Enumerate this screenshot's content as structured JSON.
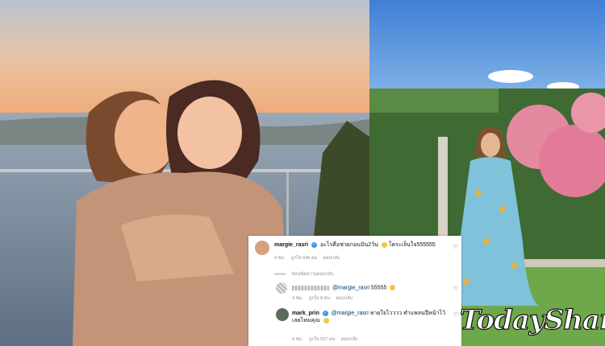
{
  "comments": [
    {
      "username": "margie_rasri",
      "text": "อะไรคือช่วยกอนปัน2วัน",
      "text2": "โดระเจ็นใจ555555",
      "time": "4 ชม.",
      "likes": "ถูกใจ 646 คน",
      "reply": "ตอบกลับ"
    },
    {
      "hide_replies": "ซ่อนข้อความตอบกลับ"
    },
    {
      "username": "",
      "mention": "@margie_rasri",
      "text": "55555",
      "time": "4 ชม.",
      "likes": "ถูกใจ 8 คน",
      "reply": "ตอบกลับ"
    },
    {
      "username": "mark_prin",
      "mention": "@margie_rasri",
      "text": "หายใจไวววว ทำแพลนปีหน้าไว้เลยไหมคุณ",
      "time": "4 ชม.",
      "likes": "ถูกใจ 507 คน",
      "reply": "ตอบกลับ"
    }
  ],
  "watermark": "TodaySharing.com",
  "colors": {
    "verified": "#3897f0",
    "mention": "#00376b",
    "meta": "#8e8e8e"
  }
}
